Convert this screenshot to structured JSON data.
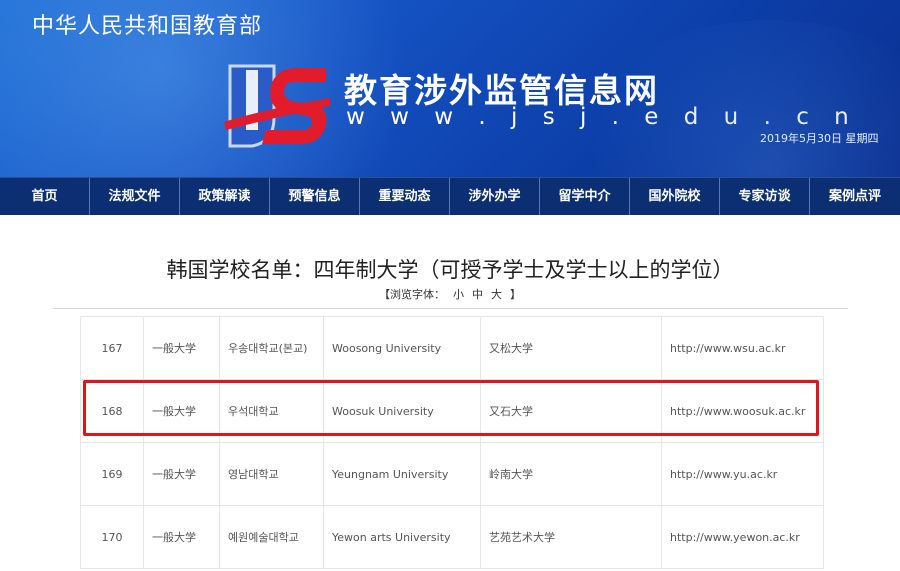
{
  "header": {
    "ministry": "中华人民共和国教育部",
    "site_title": "教育涉外监管信息网",
    "site_url": "w w w . j s j . e d u . c n",
    "date": "2019年5月30日  星期四"
  },
  "nav": [
    "首页",
    "法规文件",
    "政策解读",
    "预警信息",
    "重要动态",
    "涉外办学",
    "留学中介",
    "国外院校",
    "专家访谈",
    "案例点评"
  ],
  "page": {
    "title": "韩国学校名单：四年制大学（可授予学士及学士以上的学位）",
    "font_size_label": "【浏览字体：",
    "font_sizes": [
      "小",
      "中",
      "大"
    ],
    "font_size_end": "】"
  },
  "table": {
    "rows": [
      {
        "id": "167",
        "type": "一般大学",
        "korean": "우송대학교(본교)",
        "english": "Woosong  University",
        "chinese": "又松大学",
        "url": "http://www.wsu.ac.kr"
      },
      {
        "id": "168",
        "type": "一般大学",
        "korean": "우석대학교",
        "english": "Woosuk  University",
        "chinese": "又石大学",
        "url": "http://www.woosuk.ac.kr"
      },
      {
        "id": "169",
        "type": "一般大学",
        "korean": "영남대학교",
        "english": "Yeungnam  University",
        "chinese": "岭南大学",
        "url": "http://www.yu.ac.kr"
      },
      {
        "id": "170",
        "type": "一般大学",
        "korean": "예원예술대학교",
        "english": "Yewon arts  University",
        "chinese": "艺苑艺术大学",
        "url": "http://www.yewon.ac.kr"
      }
    ]
  },
  "colors": {
    "nav_bg": "#0b2f72",
    "highlight": "#e0141c",
    "banner": "#1553c4"
  }
}
